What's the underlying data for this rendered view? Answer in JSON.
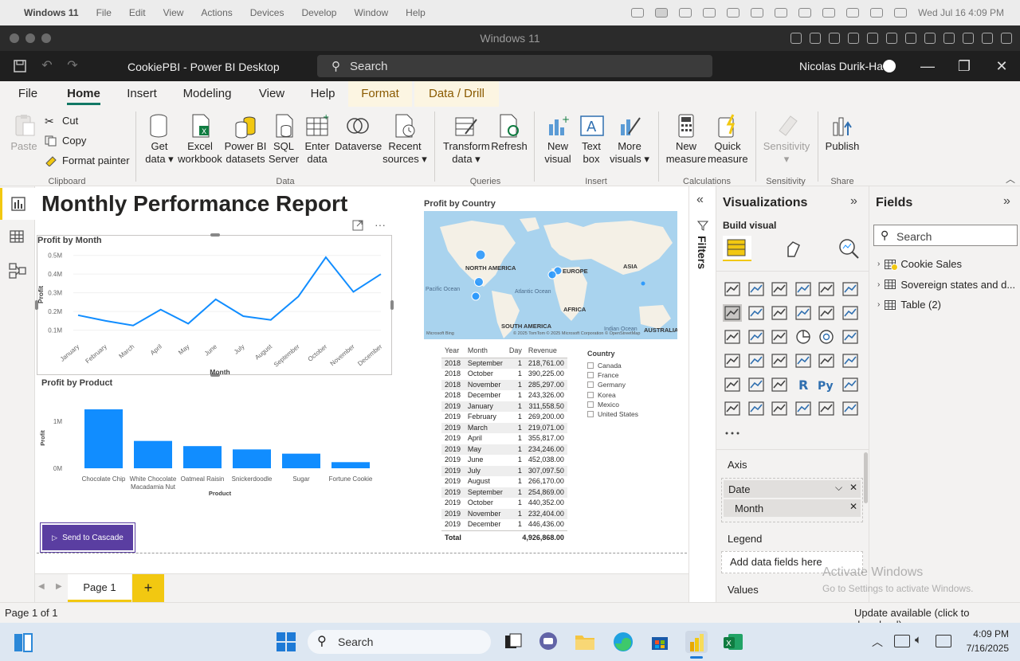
{
  "mac": {
    "menu": [
      "Windows 11",
      "File",
      "Edit",
      "View",
      "Actions",
      "Devices",
      "Develop",
      "Window",
      "Help"
    ],
    "clock": "Wed Jul 16  4:09 PM"
  },
  "vm": {
    "title": "Windows 11"
  },
  "pbi": {
    "doc_title": "CookiePBI - Power BI Desktop",
    "search": "Search",
    "user": "Nicolas Durik-Ha"
  },
  "tabs": [
    "File",
    "Home",
    "Insert",
    "Modeling",
    "View",
    "Help",
    "Format",
    "Data / Drill"
  ],
  "ribbon": {
    "paste": "Paste",
    "cut": "Cut",
    "copy": "Copy",
    "format_painter": "Format painter",
    "groups": [
      "Clipboard",
      "Data",
      "Queries",
      "Insert",
      "Calculations",
      "Sensitivity",
      "Share"
    ],
    "get_data": [
      "Get",
      "data ▾"
    ],
    "excel": [
      "Excel",
      "workbook"
    ],
    "pbi_datasets": [
      "Power BI",
      "datasets"
    ],
    "sql": [
      "SQL",
      "Server"
    ],
    "enter_data": [
      "Enter",
      "data"
    ],
    "dataverse": "Dataverse",
    "recent": [
      "Recent",
      "sources ▾"
    ],
    "transform": [
      "Transform",
      "data ▾"
    ],
    "refresh": "Refresh",
    "new_visual": [
      "New",
      "visual"
    ],
    "text_box": [
      "Text",
      "box"
    ],
    "more_visuals": [
      "More",
      "visuals ▾"
    ],
    "new_measure": [
      "New",
      "measure"
    ],
    "quick_measure": [
      "Quick",
      "measure"
    ],
    "sensitivity": [
      "Sensitivity",
      "▾"
    ],
    "publish": "Publish"
  },
  "report": {
    "title": "Monthly Performance Report",
    "send_button": "Send to Cascade",
    "page_tab": "Page 1"
  },
  "chart_data": [
    {
      "type": "line",
      "title": "Profit by Month",
      "xlabel": "Month",
      "ylabel": "Profit",
      "categories": [
        "January",
        "February",
        "March",
        "April",
        "May",
        "June",
        "July",
        "August",
        "September",
        "October",
        "November",
        "December"
      ],
      "values": [
        0.18,
        0.15,
        0.125,
        0.21,
        0.135,
        0.265,
        0.175,
        0.155,
        0.28,
        0.49,
        0.305,
        0.4
      ],
      "ytick_labels": [
        "0.1M",
        "0.2M",
        "0.3M",
        "0.4M",
        "0.5M"
      ],
      "ylim": [
        0.06,
        0.52
      ],
      "color": "#118DFF"
    },
    {
      "type": "bar",
      "title": "Profit by Product",
      "xlabel": "Product",
      "ylabel": "Profit",
      "categories": [
        "Chocolate Chip",
        "White Chocolate Macadamia Nut",
        "Oatmeal Raisin",
        "Snickerdoodle",
        "Sugar",
        "Fortune Cookie"
      ],
      "values": [
        1.25,
        0.58,
        0.47,
        0.4,
        0.31,
        0.13
      ],
      "ytick_labels": [
        "0M",
        "1M"
      ],
      "ylim": [
        0,
        1.25
      ],
      "color": "#118DFF"
    },
    {
      "type": "table",
      "columns": [
        "Year",
        "Month",
        "Day",
        "Revenue"
      ],
      "rows": [
        [
          "2018",
          "September",
          "1",
          "218,761.00"
        ],
        [
          "2018",
          "October",
          "1",
          "390,225.00"
        ],
        [
          "2018",
          "November",
          "1",
          "285,297.00"
        ],
        [
          "2018",
          "December",
          "1",
          "243,326.00"
        ],
        [
          "2019",
          "January",
          "1",
          "311,558.50"
        ],
        [
          "2019",
          "February",
          "1",
          "269,200.00"
        ],
        [
          "2019",
          "March",
          "1",
          "219,071.00"
        ],
        [
          "2019",
          "April",
          "1",
          "355,817.00"
        ],
        [
          "2019",
          "May",
          "1",
          "234,246.00"
        ],
        [
          "2019",
          "June",
          "1",
          "452,038.00"
        ],
        [
          "2019",
          "July",
          "1",
          "307,097.50"
        ],
        [
          "2019",
          "August",
          "1",
          "266,170.00"
        ],
        [
          "2019",
          "September",
          "1",
          "254,869.00"
        ],
        [
          "2019",
          "October",
          "1",
          "440,352.00"
        ],
        [
          "2019",
          "November",
          "1",
          "232,404.00"
        ],
        [
          "2019",
          "December",
          "1",
          "446,436.00"
        ]
      ],
      "total_label": "Total",
      "total": "4,926,868.00"
    }
  ],
  "map": {
    "title": "Profit by Country",
    "labels": [
      "NORTH AMERICA",
      "EUROPE",
      "ASIA",
      "Pacific Ocean",
      "Atlantic Ocean",
      "AFRICA",
      "SOUTH AMERICA",
      "AUSTRALIA",
      "Indian Ocean"
    ],
    "copyright": "© 2025 TomTom  © 2025 Microsoft Corporation  © OpenStreetMap",
    "brand": "Microsoft Bing"
  },
  "slicer": {
    "title": "Country",
    "items": [
      "Canada",
      "France",
      "Germany",
      "Korea",
      "Mexico",
      "United States"
    ]
  },
  "filters": {
    "label": "Filters"
  },
  "viz": {
    "title": "Visualizations",
    "build": "Build visual",
    "axis": "Axis",
    "axis_fields": [
      "Date",
      "Month"
    ],
    "legend": "Legend",
    "legend_placeholder": "Add data fields here",
    "values": "Values"
  },
  "fields": {
    "title": "Fields",
    "search": "Search",
    "tables": [
      "Cookie Sales",
      "Sovereign states and d...",
      "Table (2)"
    ]
  },
  "status": {
    "left": "Page 1 of 1",
    "right": "Update available (click to download)"
  },
  "watermark": {
    "line1": "Activate Windows",
    "line2": "Go to Settings to activate Windows."
  },
  "taskbar": {
    "search": "Search",
    "time": "4:09 PM",
    "date": "7/16/2025"
  },
  "colors": {
    "accent": "#117865",
    "yellow": "#F2C811",
    "series": "#118DFF",
    "button": "#5A3EA1"
  }
}
